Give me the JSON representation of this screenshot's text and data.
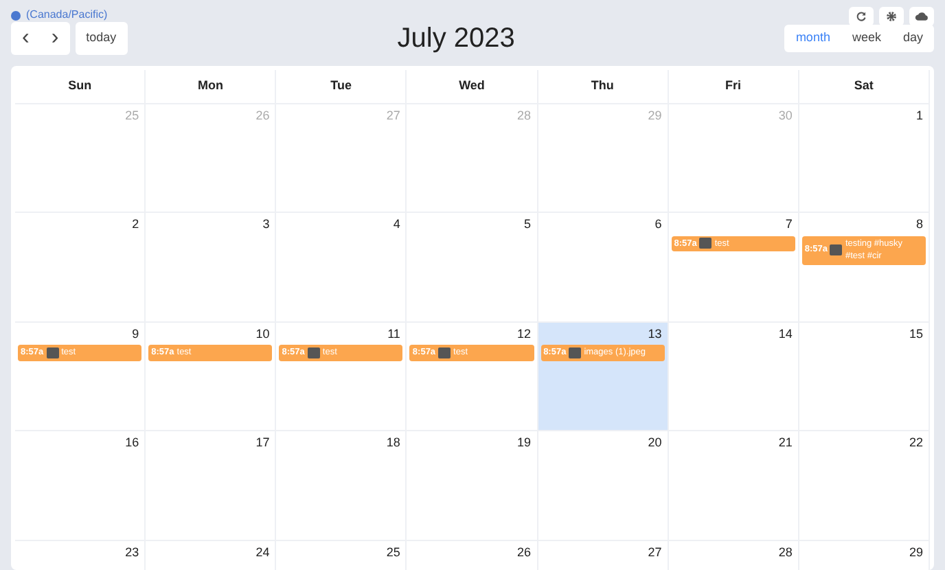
{
  "timezone": "(Canada/Pacific)",
  "toolbar": {
    "prev": "‹",
    "next": "›",
    "today": "today",
    "title": "July 2023",
    "views": [
      {
        "label": "month",
        "selected": true
      },
      {
        "label": "week",
        "selected": false
      },
      {
        "label": "day",
        "selected": false
      }
    ]
  },
  "weekdays": [
    "Sun",
    "Mon",
    "Tue",
    "Wed",
    "Thu",
    "Fri",
    "Sat"
  ],
  "weeks": [
    [
      {
        "date": "25",
        "other_month": true
      },
      {
        "date": "26",
        "other_month": true
      },
      {
        "date": "27",
        "other_month": true
      },
      {
        "date": "28",
        "other_month": true
      },
      {
        "date": "29",
        "other_month": true
      },
      {
        "date": "30",
        "other_month": true
      },
      {
        "date": "1"
      }
    ],
    [
      {
        "date": "2"
      },
      {
        "date": "3"
      },
      {
        "date": "4"
      },
      {
        "date": "5"
      },
      {
        "date": "6"
      },
      {
        "date": "7",
        "events": [
          {
            "kind": "image",
            "time": "8:57a",
            "title": "test"
          }
        ]
      },
      {
        "date": "8",
        "events": [
          {
            "kind": "image",
            "time": "8:57a",
            "title": "testing #husky #test #cir"
          }
        ]
      }
    ],
    [
      {
        "date": "9",
        "events": [
          {
            "kind": "image",
            "time": "8:57a",
            "title": "test"
          }
        ]
      },
      {
        "date": "10",
        "events": [
          {
            "kind": "plain",
            "time": "8:57a",
            "title": "test"
          }
        ]
      },
      {
        "date": "11",
        "events": [
          {
            "kind": "image",
            "time": "8:57a",
            "title": "test"
          }
        ]
      },
      {
        "date": "12",
        "events": [
          {
            "kind": "image",
            "time": "8:57a",
            "title": "test"
          }
        ]
      },
      {
        "date": "13",
        "today": true,
        "events": [
          {
            "kind": "image",
            "time": "8:57a",
            "title": "images (1).jpeg"
          }
        ]
      },
      {
        "date": "14"
      },
      {
        "date": "15"
      }
    ],
    [
      {
        "date": "16"
      },
      {
        "date": "17"
      },
      {
        "date": "18"
      },
      {
        "date": "19"
      },
      {
        "date": "20"
      },
      {
        "date": "21"
      },
      {
        "date": "22"
      }
    ],
    [
      {
        "date": "23"
      },
      {
        "date": "24"
      },
      {
        "date": "25"
      },
      {
        "date": "26"
      },
      {
        "date": "27"
      },
      {
        "date": "28"
      },
      {
        "date": "29"
      }
    ]
  ]
}
